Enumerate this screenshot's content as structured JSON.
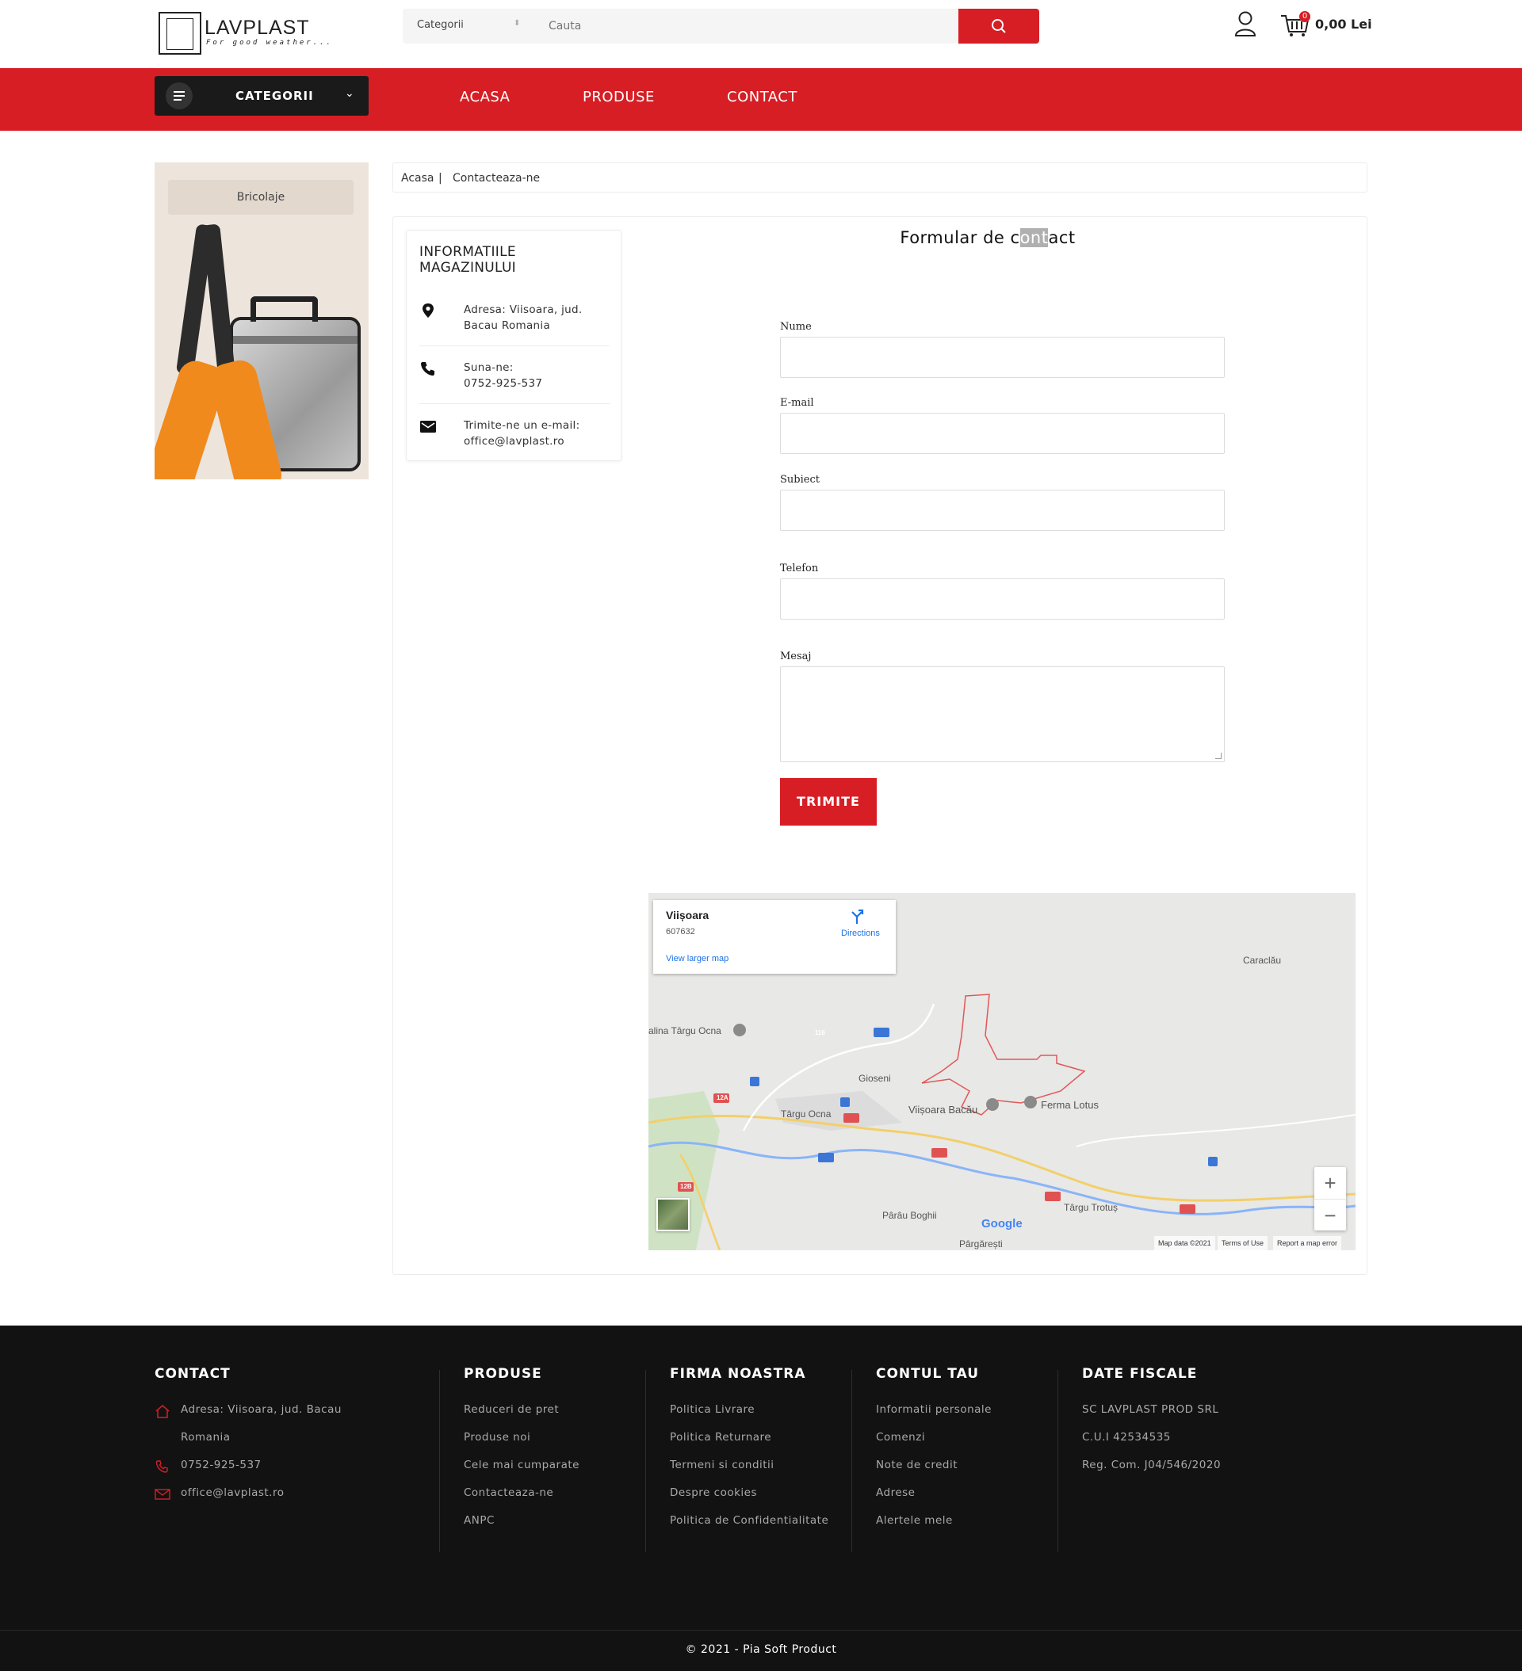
{
  "header": {
    "logo_name": "LAVPLAST",
    "logo_tagline": "For good weather...",
    "search_category": "Categorii",
    "search_placeholder": "Cauta",
    "cart_count": "0",
    "cart_total": "0,00 Lei",
    "icons": [
      "search-icon",
      "user-icon",
      "cart-icon"
    ]
  },
  "nav": {
    "categories_label": "CATEGORII",
    "links": [
      "ACASA",
      "PRODUSE",
      "CONTACT"
    ]
  },
  "sidebar": {
    "banner_title": "Bricolaje"
  },
  "breadcrumb": {
    "home": "Acasa",
    "separator": "|",
    "current": "Contacteaza-ne"
  },
  "store_info": {
    "title": "INFORMATIILE MAGAZINULUI",
    "items": [
      {
        "icon": "location-pin-icon",
        "label": "Adresa:",
        "value": "Viisoara, jud. Bacau Romania"
      },
      {
        "icon": "phone-icon",
        "label": "Suna-ne:",
        "value": "0752-925-537"
      },
      {
        "icon": "mail-icon",
        "label": "Trimite-ne un e-mail:",
        "value": "office@lavplast.ro"
      }
    ]
  },
  "contact_form": {
    "title_before": "Formular de c",
    "title_selected": "ont",
    "title_after": "act",
    "fields": {
      "name": "Nume",
      "email": "E-mail",
      "subject": "Subiect",
      "phone": "Telefon",
      "message": "Mesaj"
    },
    "submit_label": "TRIMITE"
  },
  "map": {
    "place": "Viișoara",
    "zip": "607632",
    "directions": "Directions",
    "larger_map": "View larger map",
    "labels": [
      "Caraclău",
      "alina Târgu Ocna",
      "Gioseni",
      "Târgu Ocna",
      "Viișoara Bacău",
      "Ferma Lotus",
      "Târgu Trotuș",
      "Pârâu Boghii",
      "Pârgărești"
    ],
    "road_badges": [
      "116",
      "12A",
      "12B"
    ],
    "zoom_in": "+",
    "zoom_out": "−",
    "google": "Google",
    "footer": [
      "Map data ©2021",
      "Terms of Use",
      "Report a map error"
    ]
  },
  "footer": {
    "contact": {
      "title": "CONTACT",
      "address_line1": "Adresa: Viisoara, jud. Bacau",
      "address_line2": "Romania",
      "phone": "0752-925-537",
      "email": "office@lavplast.ro"
    },
    "produse": {
      "title": "PRODUSE",
      "items": [
        "Reduceri de pret",
        "Produse noi",
        "Cele mai cumparate",
        "Contacteaza-ne",
        "ANPC"
      ]
    },
    "firma": {
      "title": "FIRMA NOASTRA",
      "items": [
        "Politica Livrare",
        "Politica Returnare",
        "Termeni si conditii",
        "Despre cookies",
        "Politica de Confidentialitate"
      ]
    },
    "cont": {
      "title": "CONTUL TAU",
      "items": [
        "Informatii personale",
        "Comenzi",
        "Note de credit",
        "Adrese",
        "Alertele mele"
      ]
    },
    "fiscale": {
      "title": "DATE FISCALE",
      "items": [
        "SC LAVPLAST PROD SRL",
        "C.U.I 42534535",
        "Reg. Com. J04/546/2020"
      ]
    },
    "copyright": "© 2021 - Pia Soft Product"
  },
  "colors": {
    "accent": "#d71e25",
    "dark": "#1a1a1a",
    "footer_bg": "#121212"
  }
}
